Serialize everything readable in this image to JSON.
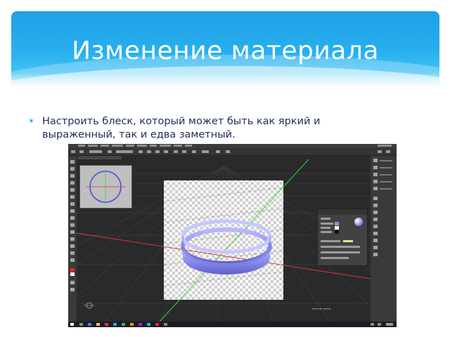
{
  "slide": {
    "title": "Изменение материала",
    "bullet": "Настроить блеск, который может быть как яркий и выраженный, так и едва заметный."
  },
  "screenshot": {
    "app": "Adobe Photoshop (3D workspace)",
    "colors": {
      "workspace": "#2b2b2b",
      "ring": "#8d8ef0",
      "x_axis": "#d43a3a",
      "y_axis": "#3ad43a",
      "z_axis": "#6a6af0"
    },
    "icons": [
      "3d-ring-object",
      "navigator-preview",
      "properties-panel",
      "material-sphere-icon"
    ]
  }
}
